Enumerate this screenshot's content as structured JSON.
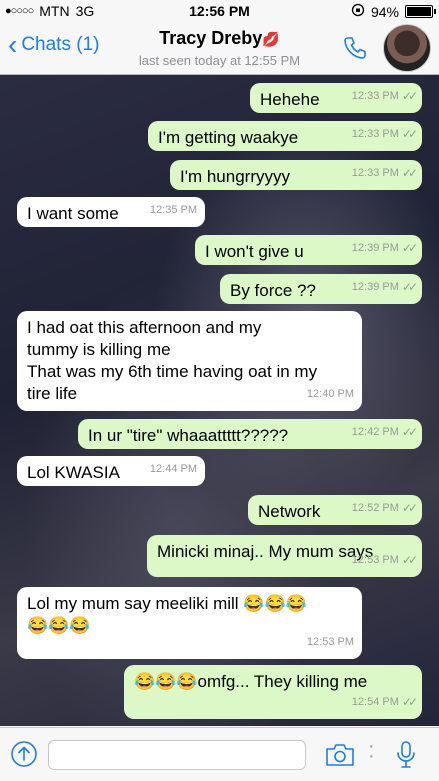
{
  "status_bar": {
    "signal": "●○○○○",
    "carrier": "MTN",
    "network": "3G",
    "time": "12:56 PM",
    "battery": "94%"
  },
  "header": {
    "back_label": "Chats (1)",
    "contact_name": "Tracy Dreby",
    "contact_emoji": "💋",
    "last_seen": "last seen today at 12:55 PM",
    "accent_color": "#1a7cf6"
  },
  "messages": [
    {
      "dir": "out",
      "text": "Hehehe",
      "time": "12:33 PM",
      "ticks": "✓✓"
    },
    {
      "dir": "out",
      "text": "I'm getting waakye",
      "time": "12:33 PM",
      "ticks": "✓✓"
    },
    {
      "dir": "out",
      "text": "I'm hungrryyyy",
      "time": "12:33 PM",
      "ticks": "✓✓"
    },
    {
      "dir": "in",
      "text": "I want some",
      "time": "12:35 PM"
    },
    {
      "dir": "out",
      "text": "I won't give u",
      "time": "12:39 PM",
      "ticks": "✓✓"
    },
    {
      "dir": "out",
      "text": "By force ??",
      "time": "12:39 PM",
      "ticks": "✓✓"
    },
    {
      "dir": "in",
      "text": "I had oat this afternoon and my\ntummy is killing me\nThat was my 6th time having oat in my\ntire life",
      "time": "12:40 PM"
    },
    {
      "dir": "out",
      "text": "In ur \"tire\" whaaattttt?????",
      "time": "12:42 PM",
      "ticks": "✓✓"
    },
    {
      "dir": "in",
      "text": "Lol KWASIA",
      "time": "12:44 PM"
    },
    {
      "dir": "out",
      "text": "Network",
      "time": "12:52 PM",
      "ticks": "✓✓"
    },
    {
      "dir": "out",
      "text": "Minicki minaj.. My mum says",
      "time": "12:53 PM",
      "ticks": "✓✓"
    },
    {
      "dir": "in",
      "text": "Lol my mum say meeliki mill 😂😂😂\n😂😂😂",
      "time": "12:53 PM"
    },
    {
      "dir": "out",
      "text": "😂😂😂omfg... They killing me",
      "time": "12:54 PM",
      "ticks": "✓✓"
    }
  ],
  "colors": {
    "outgoing_bubble": "#dcf8c6",
    "incoming_bubble": "#ffffff",
    "accent": "#1a7cf6"
  },
  "input_bar": {
    "message_placeholder": ""
  }
}
